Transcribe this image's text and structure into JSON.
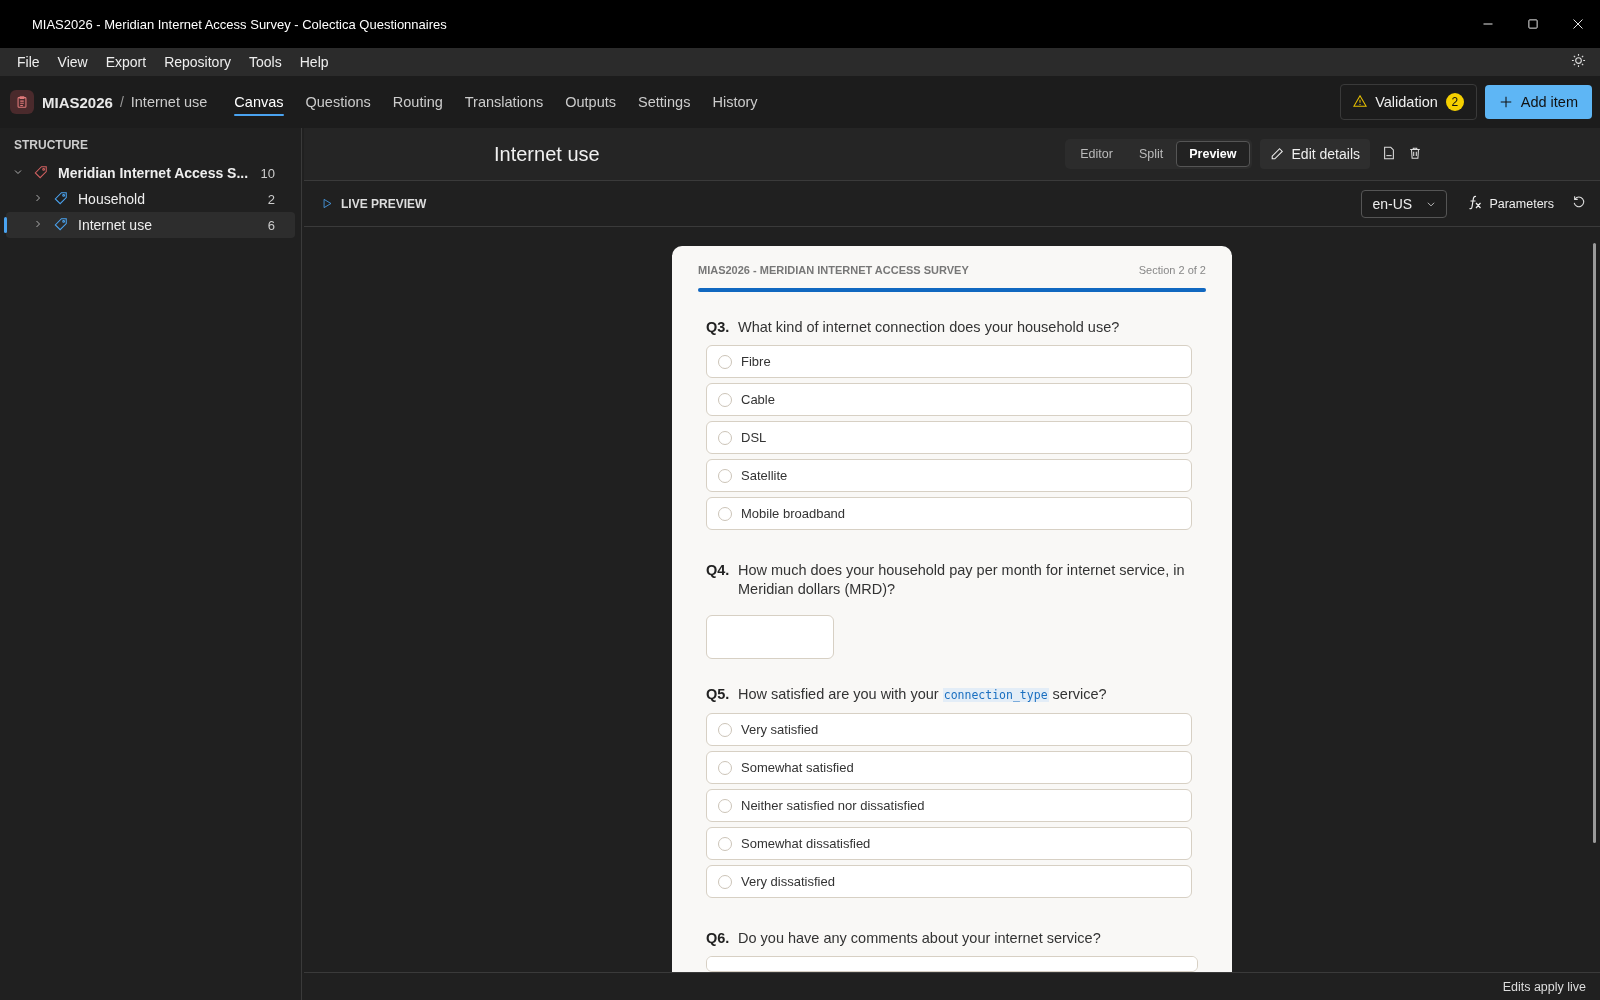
{
  "window": {
    "title": "MIAS2026 - Meridian Internet Access Survey - Colectica Questionnaires"
  },
  "menu": [
    "File",
    "View",
    "Export",
    "Repository",
    "Tools",
    "Help"
  ],
  "header": {
    "project": "MIAS2026",
    "separator": "/",
    "section": "Internet use",
    "tabs": [
      {
        "label": "Canvas",
        "selected": true
      },
      {
        "label": "Questions",
        "selected": false
      },
      {
        "label": "Routing",
        "selected": false
      },
      {
        "label": "Translations",
        "selected": false
      },
      {
        "label": "Outputs",
        "selected": false
      },
      {
        "label": "Settings",
        "selected": false
      },
      {
        "label": "History",
        "selected": false
      }
    ],
    "validation": {
      "label": "Validation",
      "count": "2"
    },
    "add_button": "Add item"
  },
  "sidebar": {
    "heading": "STRUCTURE",
    "items": [
      {
        "label": "Meridian Internet Access S...",
        "count": "10",
        "expanded": true,
        "selected": false,
        "children": [
          {
            "label": "Household",
            "count": "2",
            "expanded": false,
            "selected": false
          },
          {
            "label": "Internet use",
            "count": "6",
            "expanded": false,
            "selected": true
          }
        ]
      }
    ]
  },
  "main": {
    "title": "Internet use",
    "view_modes": [
      {
        "label": "Editor",
        "selected": false
      },
      {
        "label": "Split",
        "selected": false
      },
      {
        "label": "Preview",
        "selected": true
      }
    ],
    "edit_button": "Edit details"
  },
  "preview": {
    "label": "LIVE PREVIEW",
    "language": "en-US",
    "parameters": "Parameters"
  },
  "survey": {
    "title": "MIAS2026 - MERIDIAN INTERNET ACCESS SURVEY",
    "section": "Section 2 of 2",
    "progress": {
      "level": 1
    },
    "questions": [
      {
        "number": "Q3.",
        "kind": "choice",
        "text": "What kind of internet connection does your household use?",
        "options": [
          {
            "label": "Fibre",
            "selected": false
          },
          {
            "label": "Cable",
            "selected": false
          },
          {
            "label": "DSL",
            "selected": false
          },
          {
            "label": "Satellite",
            "selected": false
          },
          {
            "label": "Mobile broadband",
            "selected": false
          }
        ]
      },
      {
        "number": "Q4.",
        "kind": "number",
        "text": "How much does your household pay per month for internet service, in Meridian dollars (MRD)?"
      },
      {
        "number": "Q5.",
        "kind": "choice",
        "text": "How satisfied are you with your",
        "variable": "connection_type",
        "text_after": "service?",
        "options": [
          {
            "label": "Very satisfied",
            "selected": false
          },
          {
            "label": "Somewhat satisfied",
            "selected": false
          },
          {
            "label": "Neither satisfied nor dissatisfied",
            "selected": false
          },
          {
            "label": "Somewhat dissatisfied",
            "selected": false
          },
          {
            "label": "Very dissatisfied",
            "selected": false
          }
        ]
      },
      {
        "number": "Q6.",
        "kind": "text",
        "text": "Do you have any comments about your internet service?"
      }
    ]
  },
  "status_bar": "Edits apply live"
}
